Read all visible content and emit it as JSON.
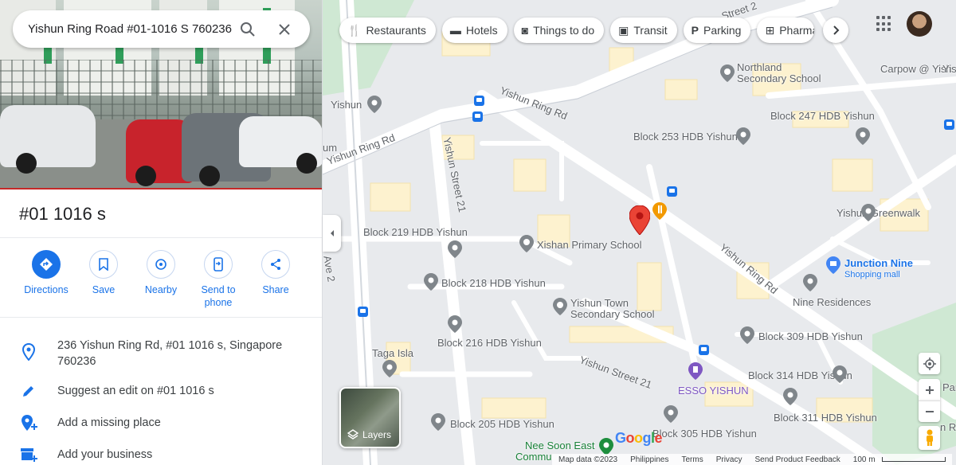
{
  "search": {
    "query": "Yishun Ring Road #01-1016 S 760236"
  },
  "place": {
    "title": "#01 1016 s",
    "address": "236 Yishun Ring Rd, #01 1016 s, Singapore 760236",
    "suggest_edit": "Suggest an edit on #01 1016 s",
    "add_missing": "Add a missing place",
    "add_business": "Add your business"
  },
  "actions": [
    {
      "label": "Directions",
      "icon": "directions-icon"
    },
    {
      "label": "Save",
      "icon": "bookmark-icon"
    },
    {
      "label": "Nearby",
      "icon": "nearby-icon"
    },
    {
      "label": "Send to phone",
      "icon": "send-to-phone-icon"
    },
    {
      "label": "Share",
      "icon": "share-icon"
    }
  ],
  "chips": [
    {
      "label": "Restaurants",
      "icon": "restaurant-icon"
    },
    {
      "label": "Hotels",
      "icon": "hotel-icon"
    },
    {
      "label": "Things to do",
      "icon": "camera-icon"
    },
    {
      "label": "Transit",
      "icon": "transit-icon"
    },
    {
      "label": "Parking",
      "icon": "parking-icon"
    },
    {
      "label": "Pharma",
      "icon": "pharmacy-icon"
    }
  ],
  "map_labels": {
    "northland": "Northland Secondary School",
    "carpow": "Carpow @ Yish",
    "block247": "Block 247 HDB Yishun",
    "block253": "Block 253 HDB Yishun",
    "yishun_greenwalk": "Yishun Greenwalk",
    "block219": "Block 219 HDB Yishun",
    "xishan": "Xishan Primary School",
    "junction_nine": "Junction Nine",
    "shopping_mall": "Shopping mall",
    "block218": "Block 218 HDB Yishun",
    "yishun_town_sec": "Yishun Town Secondary School",
    "nine_residences": "Nine Residences",
    "block216": "Block 216 HDB Yishun",
    "block309": "Block 309 HDB Yishun",
    "taga_isla": "Taga Isla",
    "block314": "Block 314 HDB Yishun",
    "esso": "ESSO YISHUN",
    "block311": "Block 311 HDB Yishun",
    "block205": "Block 205 HDB Yishun",
    "block305": "Block 305 HDB Yishun",
    "nee_soon_east": "Nee Soon East",
    "commu": "Commu",
    "yishun_left": "Yishun",
    "um": "um",
    "yishun_ring_rd_1": "Yishun Ring Rd",
    "yishun_ring_rd_2": "Yishun Ring Rd",
    "yishun_ring_rd_3": "Yishun Ring Rd",
    "yishun_street_21": "Yishun Street 21",
    "yishun_street_21b": "Yishun Street 21",
    "ave_2": "Ave 2",
    "street_top": "Street 2",
    "right_edge_1": "Yishun",
    "right_edge_2": "Par",
    "right_edge_3": "n Rd"
  },
  "layers_label": "Layers",
  "footer": {
    "map_data": "Map data ©2023",
    "philippines": "Philippines",
    "terms": "Terms",
    "privacy": "Privacy",
    "feedback": "Send Product Feedback",
    "scale": "100 m"
  },
  "google_logo": "Google",
  "colors": {
    "accent": "#1a73e8",
    "pin": "#ea4335",
    "map_bg": "#e8eaed",
    "road": "#ffffff",
    "block": "#fdf2cf"
  }
}
